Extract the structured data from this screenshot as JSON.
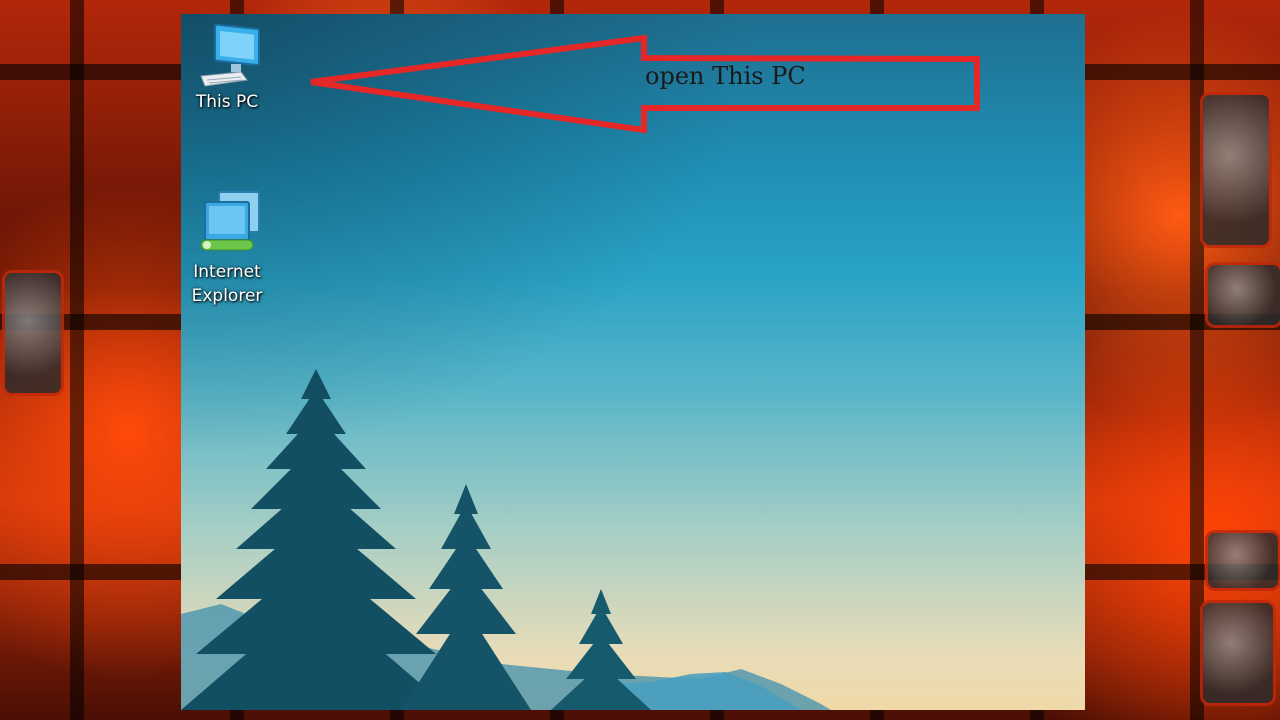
{
  "desktop": {
    "icons": [
      {
        "label": "This PC",
        "icon": "computer-icon"
      },
      {
        "label": "Internet\nExplorer",
        "label_line1": "Internet",
        "label_line2": "Explorer",
        "icon": "network-icon"
      }
    ]
  },
  "annotation": {
    "text": "open This PC",
    "arrow_color": "#e52727",
    "points_to": "This PC"
  },
  "colors": {
    "frame": "#b3270a",
    "sky_top": "#1f6f90",
    "sky_bottom": "#f0d9a8",
    "tree": "#124a5c"
  }
}
